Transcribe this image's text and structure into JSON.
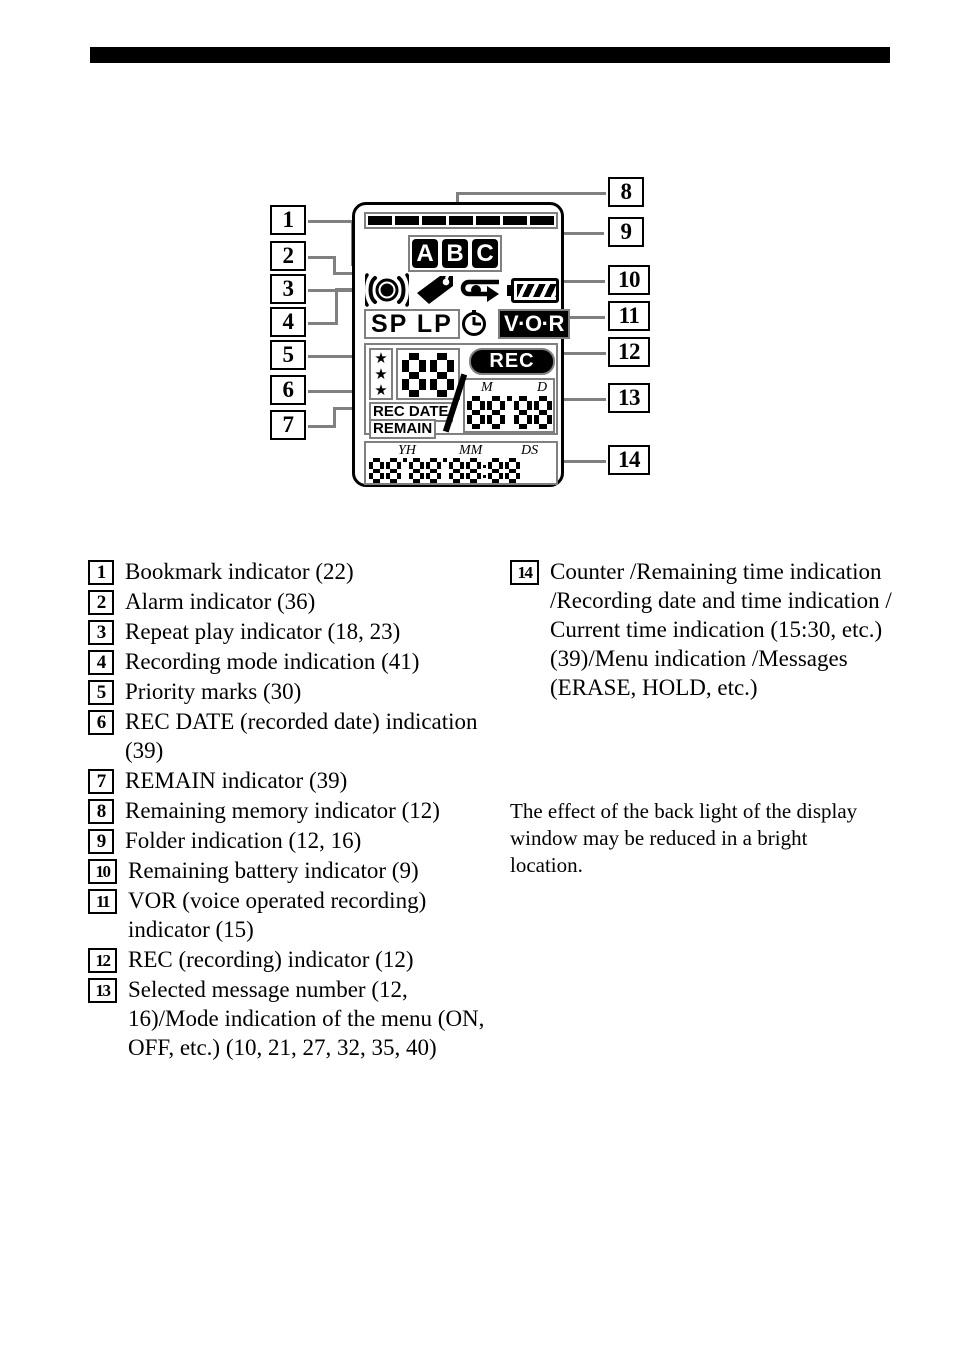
{
  "page": {
    "top_rule": true
  },
  "display": {
    "memory_bar_segments": 7,
    "folders": [
      "A",
      "B",
      "C"
    ],
    "icons": {
      "alarm": "alarm-bell-icon",
      "bookmark": "bookmark-tag-icon",
      "repeat": "repeat-play-loop-icon",
      "battery": "battery-full-icon",
      "clock": "clock-timer-icon"
    },
    "rec_mode": "SP LP",
    "vor_label": "V·O·R",
    "rec_badge": "REC",
    "rec_date_label": "REC DATE",
    "remain_label": "REMAIN",
    "priority_stars": 3,
    "message_number": "88",
    "date_value": "88.88",
    "date_labels": {
      "month": "M",
      "day": "D"
    },
    "counter_value": "88.88.88:88",
    "counter_labels": [
      "YH",
      "MM",
      "DS"
    ]
  },
  "callouts": {
    "left": [
      "1",
      "2",
      "3",
      "4",
      "5",
      "6",
      "7"
    ],
    "right": [
      "8",
      "9",
      "10",
      "11",
      "12",
      "13",
      "14"
    ]
  },
  "legend_left": [
    {
      "num": "1",
      "text": "Bookmark indicator (22)"
    },
    {
      "num": "2",
      "text": "Alarm indicator (36)"
    },
    {
      "num": "3",
      "text": "Repeat play indicator (18, 23)"
    },
    {
      "num": "4",
      "text": "Recording mode indication (41)"
    },
    {
      "num": "5",
      "text": "Priority marks (30)"
    },
    {
      "num": "6",
      "text": "REC DATE (recorded date) indication (39)"
    },
    {
      "num": "7",
      "text": "REMAIN indicator (39)"
    },
    {
      "num": "8",
      "text": "Remaining memory indicator (12)"
    },
    {
      "num": "9",
      "text": "Folder indication (12, 16)"
    },
    {
      "num": "10",
      "text": "Remaining battery indicator  (9)"
    },
    {
      "num": "11",
      "text": "VOR (voice operated recording) indicator (15)"
    },
    {
      "num": "12",
      "text": "REC (recording) indicator (12)"
    },
    {
      "num": "13",
      "text": "Selected message number (12, 16)/Mode indication of the menu (ON, OFF, etc.) (10, 21, 27, 32, 35, 40)"
    }
  ],
  "legend_right": [
    {
      "num": "14",
      "text": "Counter /Remaining time indication /Recording date and time indication / Current time indication (15:30, etc.) (39)/Menu indication /Messages (ERASE, HOLD, etc.)"
    }
  ],
  "note": "The effect of the back light of the display window may be reduced in a bright location."
}
